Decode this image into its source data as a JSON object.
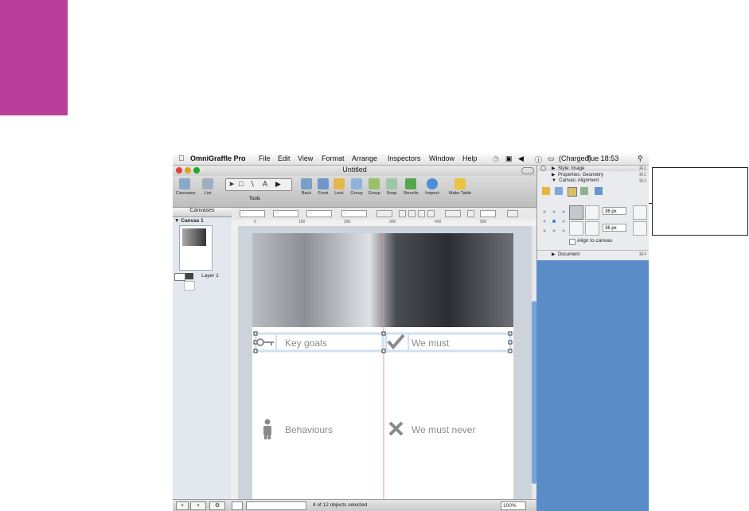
{
  "menubar": {
    "app_name": "OmniGraffle Pro",
    "items": [
      "File",
      "Edit",
      "View",
      "Format",
      "Arrange",
      "Inspectors",
      "Window",
      "Help"
    ],
    "battery": "(Charged)",
    "clock": "Tue 18:53"
  },
  "window": {
    "title": "Untitled",
    "toolbar": {
      "left_buttons": [
        "Canvases",
        "List"
      ],
      "tools_label": "Tools",
      "right_buttons": [
        "Back",
        "Front",
        "Lock",
        "Group",
        "Group",
        "Snap",
        "Stencils",
        "Inspect",
        "Make Table"
      ]
    },
    "sidebar": {
      "header": "Canvases",
      "canvas_name": "Canvas 1",
      "layer_name": "Layer 1"
    },
    "format_bar": {
      "fields": [
        "--",
        "--",
        "--",
        "--"
      ]
    },
    "ruler_ticks": [
      "0",
      "100",
      "200",
      "300",
      "400",
      "500"
    ],
    "status": {
      "selection": "4 of 12 objects selected",
      "zoom": "100%"
    }
  },
  "canvas": {
    "cards": [
      {
        "label": "Key goals",
        "icon": "key-icon"
      },
      {
        "label": "We must",
        "icon": "checkmark-icon"
      },
      {
        "label": "Behaviours",
        "icon": "person-icon"
      },
      {
        "label": "We must never",
        "icon": "cross-icon"
      }
    ]
  },
  "inspector": {
    "rows": [
      "Style: Image",
      "Properties: Geometry",
      "Canvas: Alignment"
    ],
    "shortcuts": [
      "⌘1",
      "⌘2",
      "⌘3",
      "⌘4"
    ],
    "spacing_h": "36 px",
    "spacing_v": "36 px",
    "align_to_canvas": "Align to canvas",
    "document_row": "Document"
  },
  "colors": {
    "accent_magenta": "#b8409a",
    "desktop_blue": "#5a8cc8",
    "card_border": "#cfe0f2",
    "guide_red": "#e59aa6"
  }
}
